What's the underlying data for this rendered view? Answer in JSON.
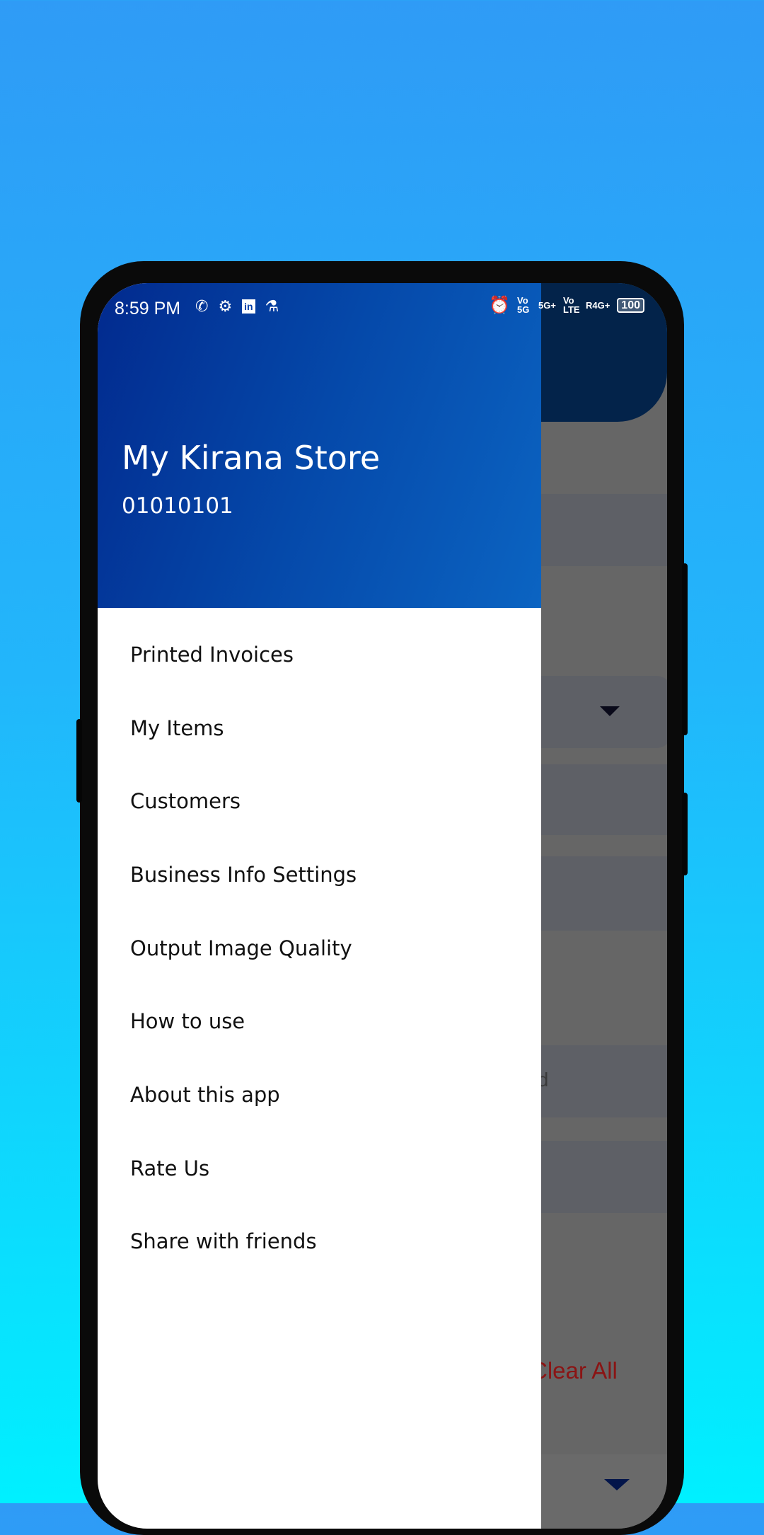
{
  "status_bar": {
    "time": "8:59 PM",
    "left_icons": [
      "whatsapp-icon",
      "settings-icon",
      "linkedin-icon",
      "flask-icon"
    ],
    "right_icons": [
      "alarm-icon",
      "vo-5g",
      "5g-plus-signal",
      "vo-lte",
      "r4g-plus-signal"
    ],
    "vo5g": "Vo 5G",
    "sig1": "5G+",
    "volte": "Vo LTE",
    "sig2": "R4G+",
    "battery": "100"
  },
  "drawer": {
    "title": "My Kirana Store",
    "subtitle": "01010101",
    "items": [
      {
        "label": "Printed Invoices"
      },
      {
        "label": "My Items"
      },
      {
        "label": "Customers"
      },
      {
        "label": "Business Info Settings"
      },
      {
        "label": "Output Image Quality"
      },
      {
        "label": "How to use"
      },
      {
        "label": "About this app"
      },
      {
        "label": "Rate Us"
      },
      {
        "label": "Share with friends"
      }
    ]
  },
  "background_screen": {
    "partial_paid_text": "aid",
    "clear_all": "Clear All"
  },
  "colors": {
    "header_start": "#022a8e",
    "header_end": "#0b64c2",
    "clear_all": "#a01a1a",
    "bg_top": "#2f9bf6",
    "bg_bottom": "#00f0ff"
  }
}
